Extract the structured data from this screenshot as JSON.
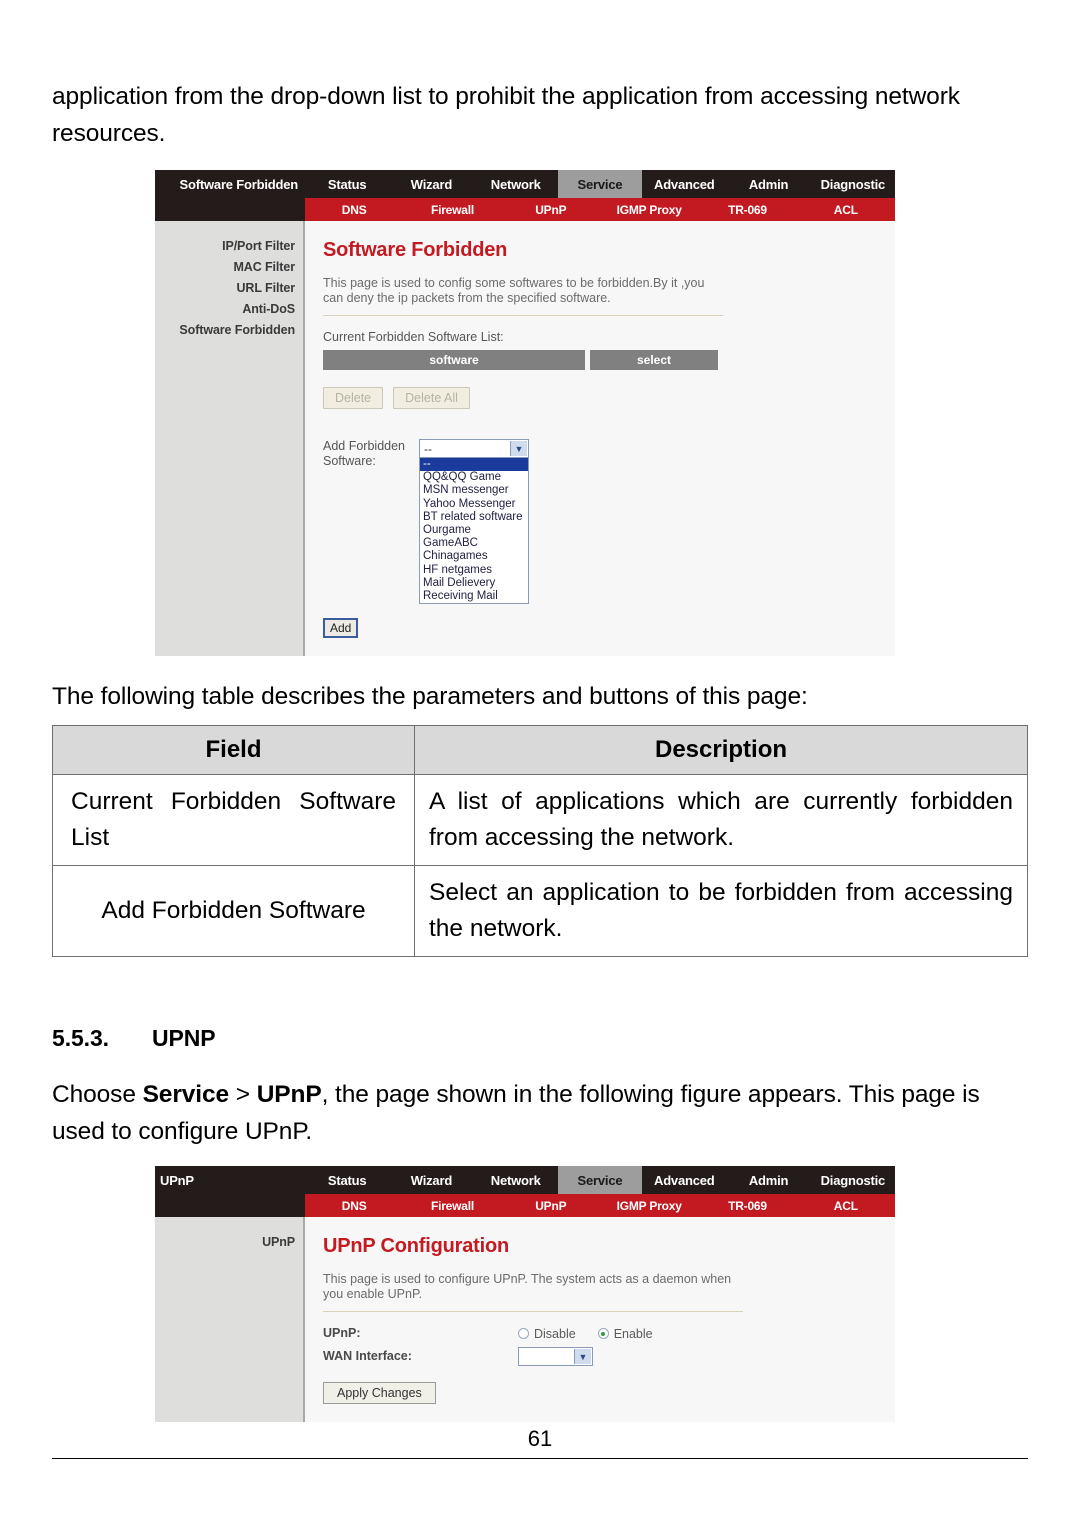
{
  "intro_paragraph": "application from the drop-down list to prohibit the application from accessing network resources.",
  "screenshot_software_forbidden": {
    "window_title": "Software Forbidden",
    "tabs": [
      "Status",
      "Wizard",
      "Network",
      "Service",
      "Advanced",
      "Admin",
      "Diagnostic"
    ],
    "active_tab": "Service",
    "subtabs": [
      "DNS",
      "Firewall",
      "UPnP",
      "IGMP Proxy",
      "TR-069",
      "ACL"
    ],
    "sidebar": [
      "IP/Port Filter",
      "MAC Filter",
      "URL Filter",
      "Anti-DoS",
      "Software Forbidden"
    ],
    "heading": "Software Forbidden",
    "description": "This page is used to config some softwares to be forbidden.By it ,you can deny the ip packets from the specified software.",
    "list_label": "Current Forbidden Software List:",
    "list_columns": [
      "software",
      "select"
    ],
    "buttons": {
      "delete": "Delete",
      "delete_all": "Delete All",
      "add": "Add"
    },
    "add_label_line1": "Add Forbidden",
    "add_label_line2": "Software:",
    "select_value": "--",
    "options": [
      "--",
      "QQ&QQ Game",
      "MSN messenger",
      "Yahoo Messenger",
      "BT related software",
      "Ourgame",
      "GameABC",
      "Chinagames",
      "HF netgames",
      "Mail Delievery",
      "Receiving Mail"
    ]
  },
  "table_intro": "The following table describes the parameters and buttons of this page:",
  "param_table": {
    "headers": [
      "Field",
      "Description"
    ],
    "rows": [
      {
        "field": "Current Forbidden Software List",
        "description": "A list of applications which are currently forbidden from accessing the network."
      },
      {
        "field": "Add Forbidden Software",
        "description": "Select an application to be forbidden from accessing the network."
      }
    ]
  },
  "section": {
    "number": "5.5.3.",
    "title": "UPNP",
    "paragraph_prefix": "Choose ",
    "paragraph_bold1": "Service",
    "paragraph_mid": " > ",
    "paragraph_bold2": "UPnP",
    "paragraph_suffix": ", the page shown in the following figure appears. This page is used to configure UPnP."
  },
  "screenshot_upnp": {
    "window_title": "UPnP",
    "tabs": [
      "Status",
      "Wizard",
      "Network",
      "Service",
      "Advanced",
      "Admin",
      "Diagnostic"
    ],
    "active_tab": "Service",
    "subtabs": [
      "DNS",
      "Firewall",
      "UPnP",
      "IGMP Proxy",
      "TR-069",
      "ACL"
    ],
    "sidebar": [
      "UPnP"
    ],
    "heading": "UPnP Configuration",
    "description": "This page is used to configure UPnP. The system acts as a daemon when you enable UPnP.",
    "upnp_label": "UPnP:",
    "radio_disable": "Disable",
    "radio_enable": "Enable",
    "selected_radio": "Enable",
    "wan_label": "WAN Interface:",
    "wan_value": "",
    "apply_button": "Apply Changes"
  },
  "footer": {
    "page_number": "61"
  },
  "colors": {
    "nav_dark": "#241c1a",
    "subnav_red": "#c31a22",
    "heading_red": "#c41a22",
    "active_tab": "#9d9d9d",
    "sidebar_gray": "#dededd",
    "table_header_gray": "#d9d9d9",
    "radio_green": "#2f9d3c"
  }
}
